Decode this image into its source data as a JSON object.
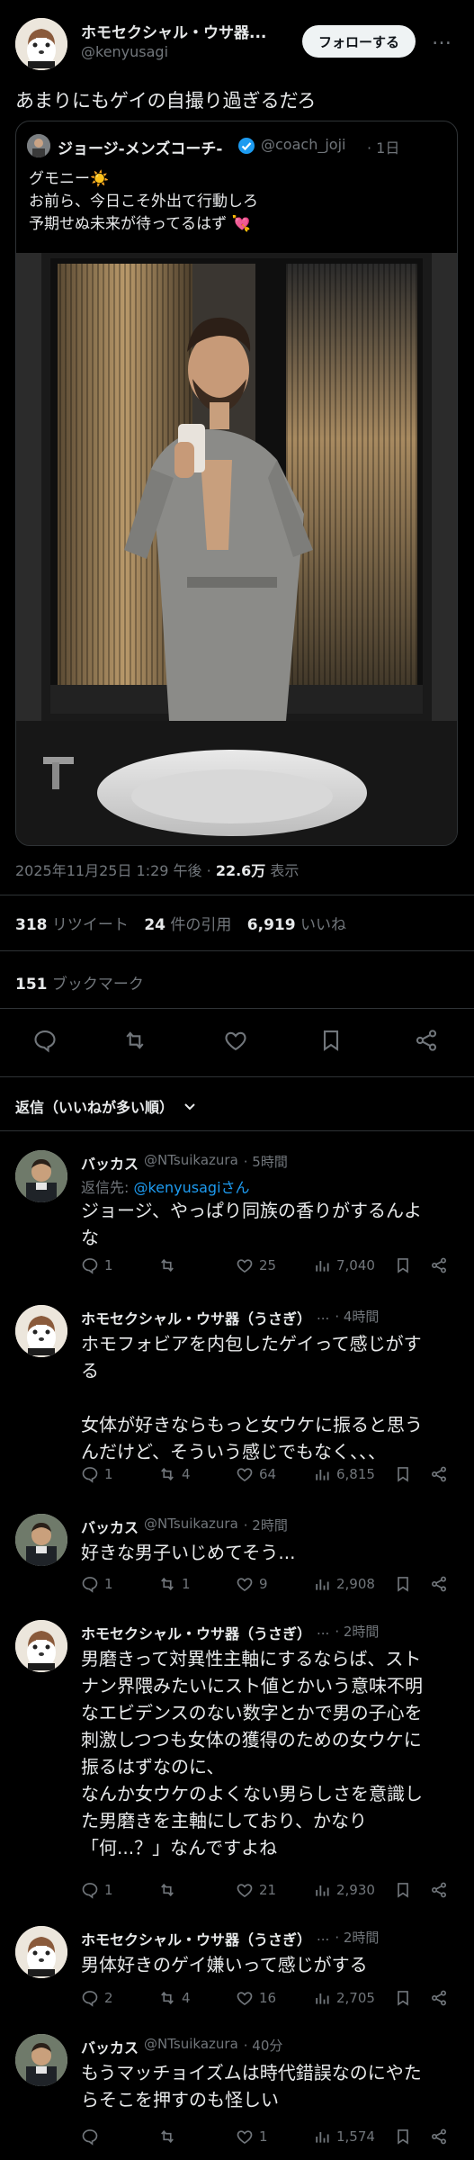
{
  "post": {
    "author_name": "ホモセクシャル・ウサ器...",
    "author_handle": "@kenyusagi",
    "follow_label": "フォローする",
    "more_label": "…",
    "text": "あまりにもゲイの自撮り過ぎるだろ"
  },
  "quote": {
    "author_name": "ジョージ-メンズコーチ-",
    "handle": "@coach_joji",
    "time": "· 1日",
    "lines": [
      "グモニー☀️",
      "お前ら、今日こそ外出て行動しろ",
      "予期せぬ未来が待ってるはず 💘"
    ]
  },
  "meta": {
    "timestamp": "2025年11月25日 1:29 午後 · ",
    "views": "22.6万",
    "views_label": " 表示"
  },
  "stats": {
    "retweets": "318",
    "retweets_label": "リツイート",
    "quotes": "24",
    "quotes_label": "件の引用",
    "likes": "6,919",
    "likes_label": "いいね",
    "bookmarks": "151",
    "bookmarks_label": "ブックマーク"
  },
  "sort": {
    "label": "返信（いいねが多い順）"
  },
  "replies": [
    {
      "name": "バッカス",
      "handle": "@NTsuikazura",
      "time": "· 5時間",
      "reply_to_prefix": "返信先: ",
      "reply_to_handle": "@kenyusagiさん",
      "lines": [
        "ジョージ、やっぱり同族の香りがするんよ",
        "な"
      ],
      "stats": {
        "replies": "1",
        "retweets": "",
        "likes": "25",
        "views": "7,040"
      }
    },
    {
      "name": "ホモセクシャル・ウサ器（うさぎ）",
      "handle": "...",
      "time": "· 4時間",
      "lines": [
        "ホモフォビアを内包したゲイって感じがす",
        "る",
        "",
        "女体が好きならもっと女ウケに振ると思う",
        "んだけど、そういう感じでもなく、、、"
      ],
      "stats": {
        "replies": "1",
        "retweets": "4",
        "likes": "64",
        "views": "6,815"
      }
    },
    {
      "name": "バッカス",
      "handle": "@NTsuikazura",
      "time": "· 2時間",
      "lines": [
        "好きな男子いじめてそう..."
      ],
      "stats": {
        "replies": "1",
        "retweets": "1",
        "likes": "9",
        "views": "2,908"
      }
    },
    {
      "name": "ホモセクシャル・ウサ器（うさぎ）",
      "handle": "...",
      "time": "· 2時間",
      "lines": [
        "男磨きって対異性主軸にするならば、スト",
        "ナン界隈みたいにスト値とかいう意味不明",
        "なエビデンスのない数字とかで男の子心を",
        "刺激しつつも女体の獲得のための女ウケに",
        "振るはずなのに、",
        "なんか女ウケのよくない男らしさを意識し",
        "た男磨きを主軸にしており、かなり",
        "「何...？」なんですよね"
      ],
      "stats": {
        "replies": "1",
        "retweets": "",
        "likes": "21",
        "views": "2,930"
      }
    },
    {
      "name": "ホモセクシャル・ウサ器（うさぎ）",
      "handle": "...",
      "time": "· 2時間",
      "lines": [
        "男体好きのゲイ嫌いって感じがする"
      ],
      "stats": {
        "replies": "2",
        "retweets": "4",
        "likes": "16",
        "views": "2,705"
      }
    },
    {
      "name": "バッカス",
      "handle": "@NTsuikazura",
      "time": "· 40分",
      "lines": [
        "もうマッチョイズムは時代錯誤なのにやた",
        "らそこを押すのも怪しい"
      ],
      "stats": {
        "replies": "",
        "retweets": "",
        "likes": "1",
        "views": "1,574"
      }
    }
  ],
  "colors": {
    "accent": "#1d9bf0",
    "background": "#000000",
    "text": "#e7e9ea",
    "muted": "#71767b"
  }
}
